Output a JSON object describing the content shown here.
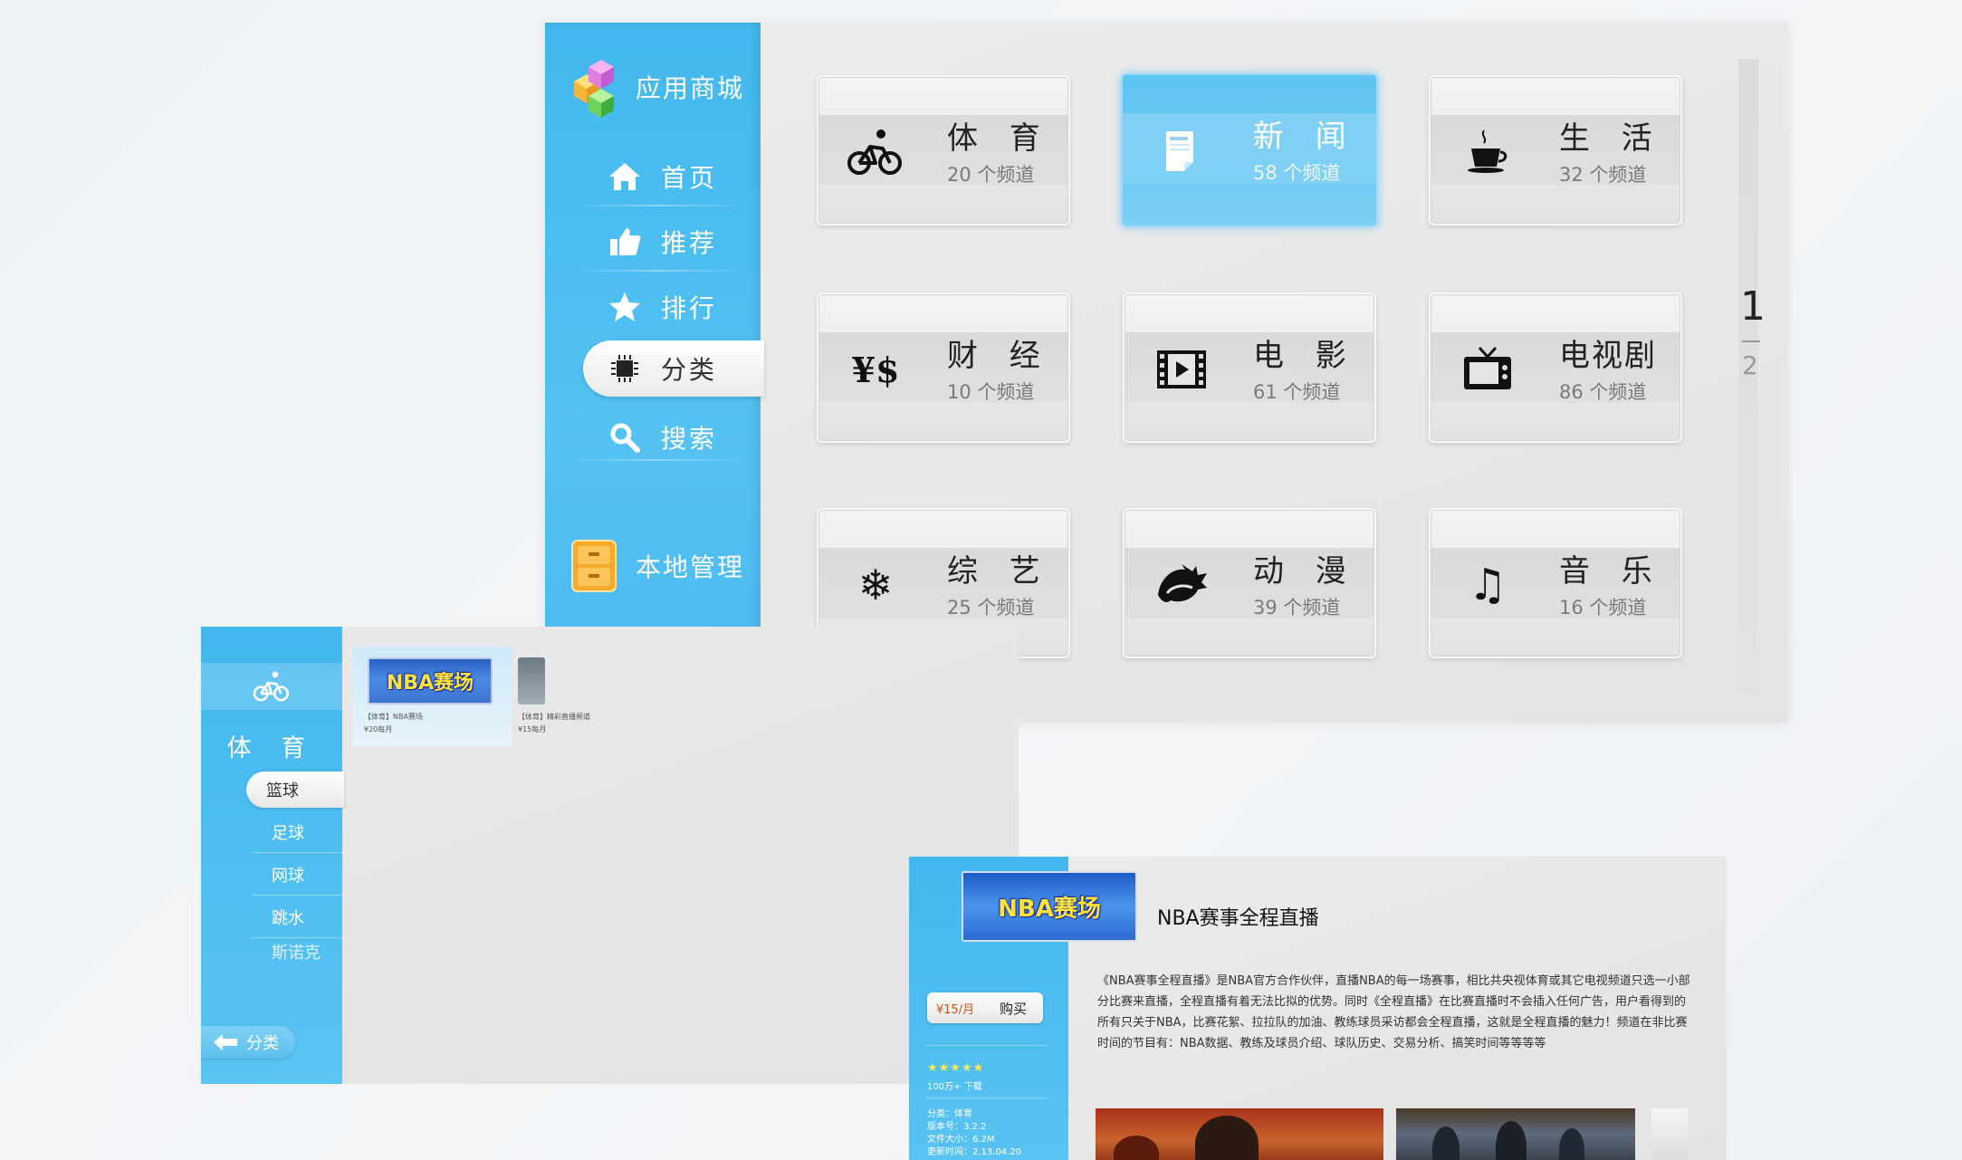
{
  "main": {
    "brand": "应用商城",
    "nav": [
      {
        "label": "首页",
        "icon": "home-icon"
      },
      {
        "label": "推荐",
        "icon": "thumbs-up-icon"
      },
      {
        "label": "排行",
        "icon": "star-icon"
      },
      {
        "label": "分类",
        "icon": "chip-icon"
      },
      {
        "label": "搜索",
        "icon": "search-icon"
      }
    ],
    "active_nav": "分类",
    "local": "本地管理",
    "tiles": [
      {
        "name": "体 育",
        "count": "20 个频道",
        "icon": "bicycle-icon"
      },
      {
        "name": "新 闻",
        "count": "58 个频道",
        "icon": "newspaper-icon"
      },
      {
        "name": "生 活",
        "count": "32 个频道",
        "icon": "coffee-cup-icon"
      },
      {
        "name": "财 经",
        "count": "10 个频道",
        "icon": "currency-icon"
      },
      {
        "name": "电 影",
        "count": "61 个频道",
        "icon": "film-icon"
      },
      {
        "name": "电视剧",
        "count": "86 个频道",
        "icon": "tv-icon"
      },
      {
        "name": "综 艺",
        "count": "25 个频道",
        "icon": "snowflake-icon"
      },
      {
        "name": "动 漫",
        "count": "39 个频道",
        "icon": "anime-hair-icon"
      },
      {
        "name": "音 乐",
        "count": "16 个频道",
        "icon": "music-note-icon"
      }
    ],
    "selected_tile": "新 闻",
    "pager": {
      "current": "1",
      "next": "2"
    }
  },
  "sports": {
    "title": "体 育",
    "subs": [
      "篮球",
      "足球",
      "网球",
      "跳水",
      "斯诺克"
    ],
    "active_sub": "篮球",
    "back": "分类",
    "apps": [
      {
        "banner": "NBA赛场",
        "caption": "【体育】NBA赛场",
        "price": "¥20每月"
      },
      {
        "banner": "",
        "caption": "【体育】精彩直播频道",
        "price": "¥15每月"
      }
    ]
  },
  "detail": {
    "banner": "NBA赛场",
    "title": "NBA赛事全程直播",
    "price": "¥15/月",
    "buy": "购买",
    "stars": "★★★★★",
    "downloads": "100万+ 下载",
    "meta": [
      "分类：体育",
      "版本号：3.2.2",
      "文件大小：6.2M",
      "更新时间：2.13.04.20"
    ],
    "desc": "《NBA赛事全程直播》是NBA官方合作伙伴，直播NBA的每一场赛事，相比共央视体育或其它电视频道只选一小部分比赛来直播，全程直播有着无法比拟的优势。同时《全程直播》在比赛直播时不会插入任何广告，用户看得到的所有只关于NBA，比赛花絮、拉拉队的加油、教练球员采访都会全程直播，这就是全程直播的魅力！频道在非比赛时间的节目有：NBA数据、教练及球员介绍、球队历史、交易分析、搞笑时间等等等等"
  },
  "colors": {
    "accent": "#43b8ee",
    "highlight": "#5ec3f2",
    "price": "#c7561f",
    "star": "#ffe55a"
  }
}
